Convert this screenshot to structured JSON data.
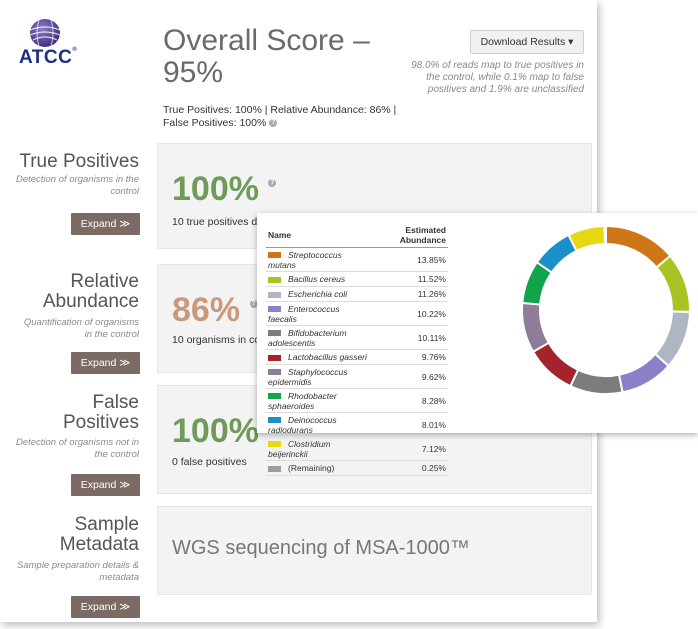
{
  "logo": {
    "text": "ATCC",
    "reg": "®"
  },
  "overall": {
    "title": "Overall Score – 95%",
    "subtitle": "True Positives: 100% | Relative Abundance: 86% | False Positives: 100%",
    "download_label": "Download Results ▾",
    "note": "98.0% of reads map to true positives in the control, while 0.1% map to false positives and 1.9% are unclassified"
  },
  "sections": {
    "true_positives": {
      "title": "True Positives",
      "desc": "Detection of organisms in the control",
      "expand": "Expand ≫",
      "pct": "100%",
      "sub": "10 true positives d"
    },
    "relative_abundance": {
      "title": "Relative Abundance",
      "desc": "Quantification of organisms in the control",
      "expand": "Expand ≫",
      "pct": "86%",
      "sub": "10 organisms in co"
    },
    "false_positives": {
      "title": "False Positives",
      "desc": "Detection of organisms not in the control",
      "expand": "Expand ≫",
      "pct": "100%",
      "sub": "0 false positives"
    },
    "sample_metadata": {
      "title": "Sample Metadata",
      "desc": "Sample preparation details & metadata",
      "expand": "Expand ≫",
      "value": "WGS sequencing of MSA-1000™"
    }
  },
  "colors": {
    "green": "#6f9a5a",
    "tan": "#c9997c",
    "button": "#7b6b64"
  },
  "chart_data": {
    "type": "pie",
    "headers": {
      "name": "Name",
      "abundance": "Estimated Abundance"
    },
    "categories": [
      "Streptococcus mutans",
      "Bacillus cereus",
      "Escherichia coli",
      "Enterococcus faecalis",
      "Bifidobacterium adolescentis",
      "Lactobacillus gasseri",
      "Staphylococcus epidermidis",
      "Rhodobacter sphaeroides",
      "Deinococcus radiodurans",
      "Clostridium beijerinckii",
      "(Remaining)"
    ],
    "labels": [
      "13.85%",
      "11.52%",
      "11.26%",
      "10.22%",
      "10.11%",
      "9.76%",
      "9.62%",
      "8.28%",
      "8.01%",
      "7.12%",
      "0.25%"
    ],
    "values": [
      13.85,
      11.52,
      11.26,
      10.22,
      10.11,
      9.76,
      9.62,
      8.28,
      8.01,
      7.12,
      0.25
    ],
    "colors": [
      "#cc7618",
      "#a8c322",
      "#aeb6c4",
      "#8a80c8",
      "#7c7c7c",
      "#a3242c",
      "#8e7c98",
      "#12a44a",
      "#1b90c8",
      "#e8d812",
      "#9d9d9d"
    ]
  }
}
